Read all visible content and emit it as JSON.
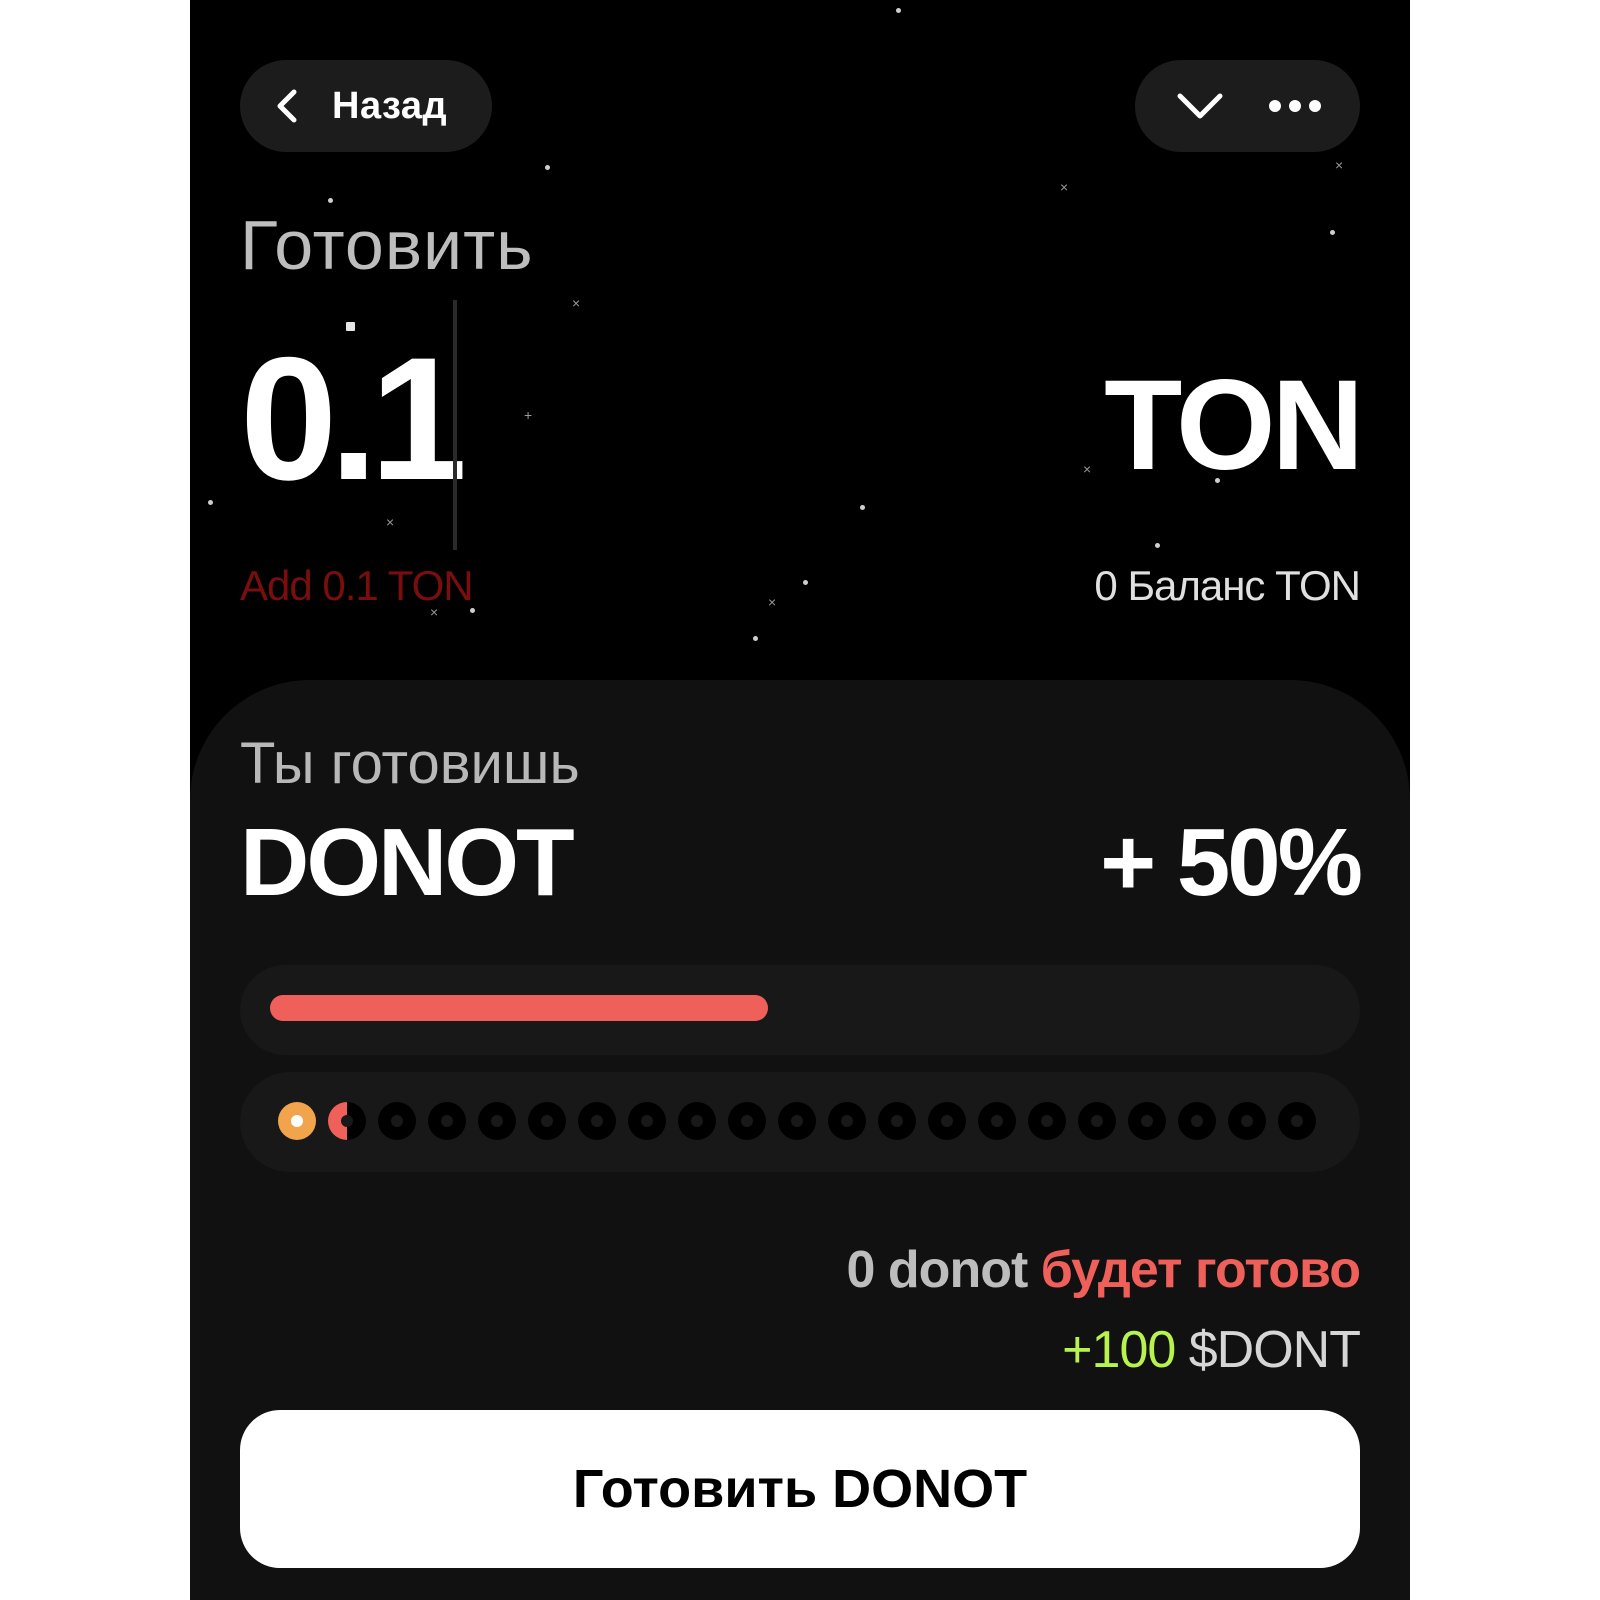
{
  "header": {
    "back_label": "Назад",
    "icons": {
      "back": "chevron-left-icon",
      "collapse": "chevron-down-icon",
      "more": "more-horizontal-icon"
    }
  },
  "input": {
    "title": "Готовить",
    "amount": "0.1",
    "currency": "TON",
    "hint": "Add 0.1 TON",
    "balance": "0 Баланс TON"
  },
  "sheet": {
    "subtitle": "Ты готовишь",
    "coin": "DONOT",
    "bonus": "+ 50%",
    "progress_fraction": 0.47,
    "donuts": {
      "total": 21,
      "ready": 1,
      "partial": 1
    },
    "ready_count": "0 donot",
    "ready_text": "будет готово",
    "reward_amount": "+100",
    "reward_token": "$DONT",
    "button_label": "Готовить DONOT"
  },
  "colors": {
    "background": "#000000",
    "sheet": "#111111",
    "accent": "#f0605a",
    "reward": "#b8f24d",
    "hint": "#7a0e0e",
    "donut_ready": "#f2a44c"
  }
}
